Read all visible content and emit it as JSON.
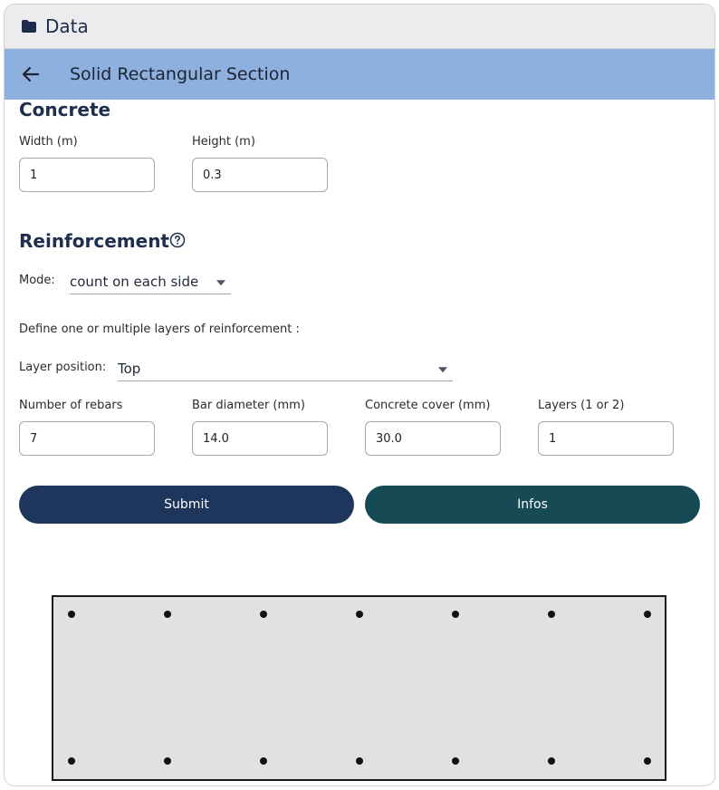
{
  "topbar": {
    "title": "Data",
    "icon": "folder-icon"
  },
  "subbar": {
    "title": "Solid Rectangular Section",
    "back_icon": "arrow-left-icon"
  },
  "concrete": {
    "heading": "Concrete",
    "width_label": "Width (m)",
    "width_value": "1",
    "height_label": "Height (m)",
    "height_value": "0.3"
  },
  "reinforcement": {
    "heading": "Reinforcement",
    "help_icon": "help-circle-icon",
    "mode_label": "Mode:",
    "mode_value": "count on each side",
    "define_text": "Define one or multiple layers of reinforcement :",
    "layer_position_label": "Layer position:",
    "layer_position_value": "Top",
    "rebars_label": "Number of rebars",
    "rebars_value": "7",
    "diameter_label": "Bar diameter (mm)",
    "diameter_value": "14.0",
    "cover_label": "Concrete cover (mm)",
    "cover_value": "30.0",
    "layers_label": "Layers (1 or 2)",
    "layers_value": "1"
  },
  "actions": {
    "submit_label": "Submit",
    "infos_label": "Infos"
  },
  "section_preview": {
    "fill_color": "#e1e1e1",
    "stroke_color": "#1a1a1a",
    "top_bar_count": 7,
    "bottom_bar_count": 7
  },
  "colors": {
    "submit": "#1f365c",
    "infos": "#164a55",
    "subbar": "#8eb0df",
    "heading": "#1e2e4f"
  }
}
